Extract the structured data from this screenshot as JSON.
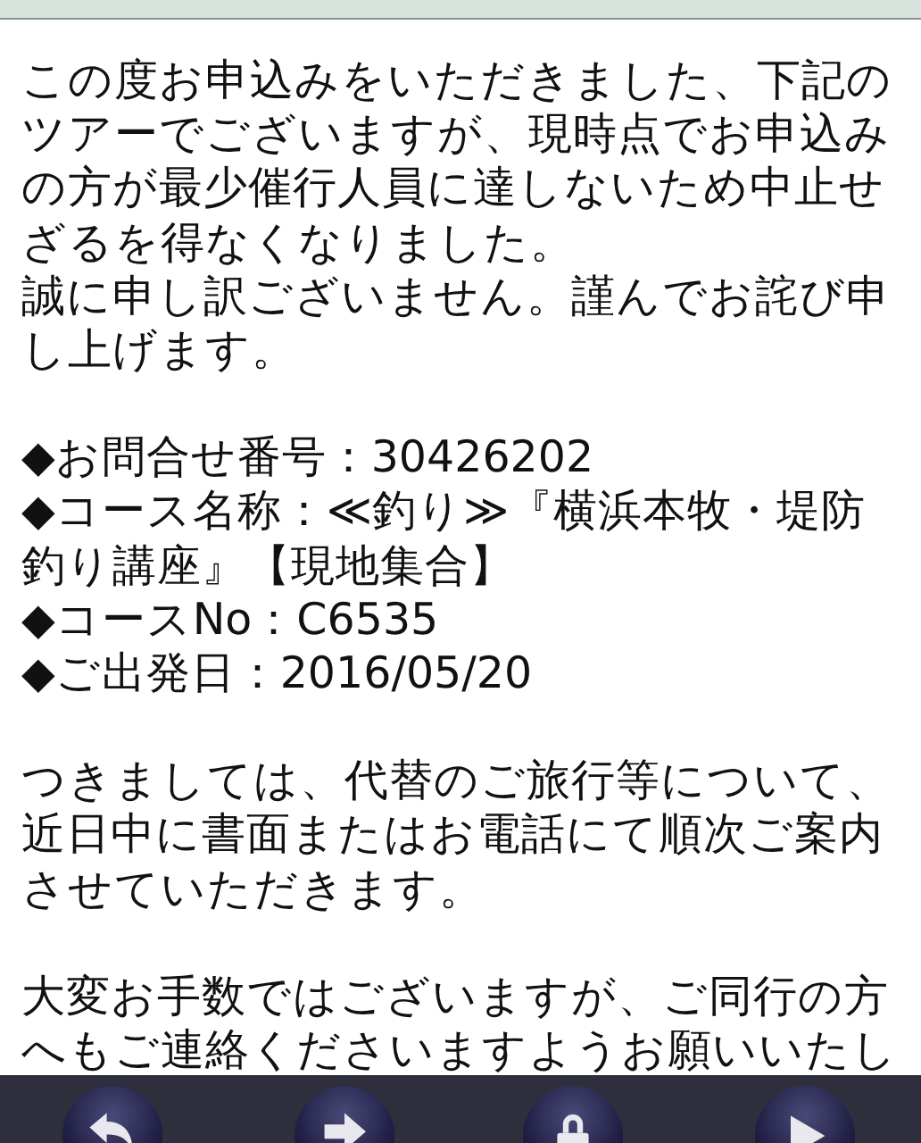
{
  "message": {
    "paragraphs": [
      {
        "lines": [
          "この度お申込みをいただきました、下記の",
          "ツアーでございますが、現時点でお申込み",
          "の方が最少催行人員に達しないため中止せ",
          "ざるを得なくなりました。",
          "誠に申し訳ございません。謹んでお詫び申",
          "し上げます。"
        ]
      },
      {
        "lines": [
          "◆お問合せ番号：30426202",
          "◆コース名称：≪釣り≫『横浜本牧・堤防",
          "釣り講座』【現地集合】",
          "◆コースNo：C6535",
          "◆ご出発日：2016/05/20"
        ]
      },
      {
        "lines": [
          "つきましては、代替のご旅行等について、",
          "近日中に書面またはお電話にて順次ご案内",
          "させていただきます。"
        ]
      },
      {
        "lines": [
          "大変お手数ではございますが、ご同行の方",
          "へもご連絡くださいますようお願いいたし"
        ]
      }
    ]
  }
}
